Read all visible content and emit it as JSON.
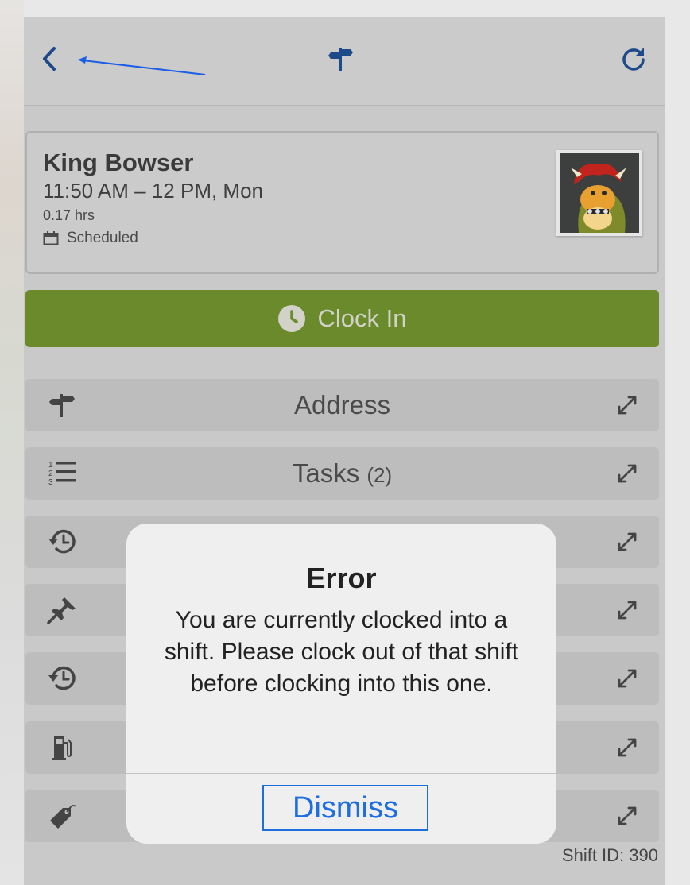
{
  "nav": {
    "back_icon": "chevron-left-icon",
    "center_icon": "signpost-icon",
    "refresh_icon": "refresh-icon",
    "accent_color": "#1f4a8a"
  },
  "shift": {
    "name": "King Bowser",
    "time": "11:50 AM – 12 PM, Mon",
    "hours": "0.17 hrs",
    "status": "Scheduled"
  },
  "clock_in": {
    "label": "Clock In",
    "color": "#6a8a2b"
  },
  "sections": [
    {
      "label": "Address",
      "count": "",
      "icon": "signpost-icon"
    },
    {
      "label": "Tasks",
      "count": "(2)",
      "icon": "numbered-list-icon"
    },
    {
      "label": "",
      "count": "",
      "icon": "history-icon"
    },
    {
      "label": "",
      "count": "",
      "icon": "pushpin-icon"
    },
    {
      "label": "",
      "count": "",
      "icon": "history-icon"
    },
    {
      "label": "",
      "count": "",
      "icon": "fuel-pump-icon"
    },
    {
      "label": "",
      "count": "",
      "icon": "price-tag-icon"
    }
  ],
  "footer": {
    "shift_id": "Shift ID: 390"
  },
  "alert": {
    "title": "Error",
    "message": "You are currently clocked into a shift. Please clock out of that shift before clocking into this one.",
    "dismiss_label": "Dismiss",
    "button_color": "#1d6ee0"
  }
}
